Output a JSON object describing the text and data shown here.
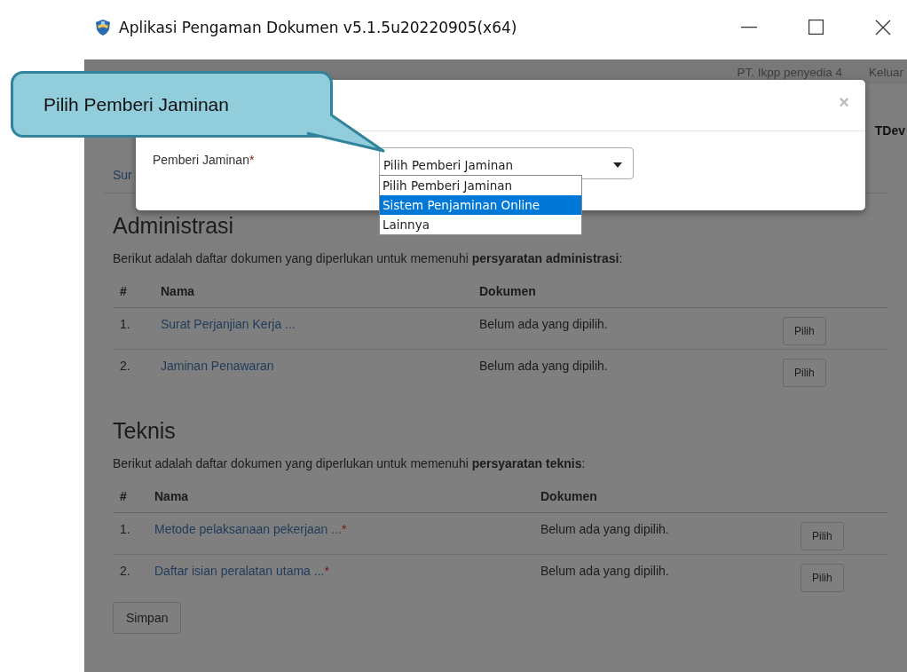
{
  "window": {
    "title": "Aplikasi Pengaman Dokumen v5.1.5u20220905(x64)"
  },
  "navbar": {
    "company": "PT. Ikpp penyedia 4",
    "logout": "Keluar"
  },
  "header_right": "TDev",
  "breadcrumb": "Sur",
  "sections": [
    {
      "heading": "Administrasi",
      "intro": "Berikut adalah daftar dokumen yang diperlukan untuk memenuhi **persyaratan administrasi**:",
      "columns": [
        "#",
        "Nama",
        "Dokumen"
      ],
      "rows": [
        {
          "number": "1.",
          "name": "Surat Perjanjian Kerja ...",
          "document": "Belum ada yang dipilih.",
          "button": "Pilih"
        },
        {
          "number": "2.",
          "name": "Jaminan Penawaran",
          "document": "Belum ada yang dipilih.",
          "button": "Pilih"
        }
      ]
    },
    {
      "heading": "Teknis",
      "intro": "Berikut adalah daftar dokumen yang diperlukan untuk memenuhi **persyaratan teknis**:",
      "columns": [
        "#",
        "Nama",
        "Dokumen"
      ],
      "rows": [
        {
          "number": "1.",
          "name": "Metode pelaksanaan pekerjaan ...",
          "required_mark": "*",
          "document": "Belum ada yang dipilih.",
          "button": "Pilih"
        },
        {
          "number": "2.",
          "name": "Daftar isian peralatan utama ...",
          "required_mark": "*",
          "document": "Belum ada yang dipilih.",
          "button": "Pilih"
        }
      ]
    }
  ],
  "save_button": "Simpan",
  "modal": {
    "close": "×",
    "label": "Pemberi Jaminan",
    "required_mark": "*",
    "select_value": "Pilih Pemberi Jaminan",
    "options": [
      {
        "label": "Pilih Pemberi Jaminan",
        "selected": false
      },
      {
        "label": "Sistem Penjaminan Online",
        "selected": true
      },
      {
        "label": "Lainnya",
        "selected": false
      }
    ]
  },
  "callout": "Pilih Pemberi Jaminan"
}
